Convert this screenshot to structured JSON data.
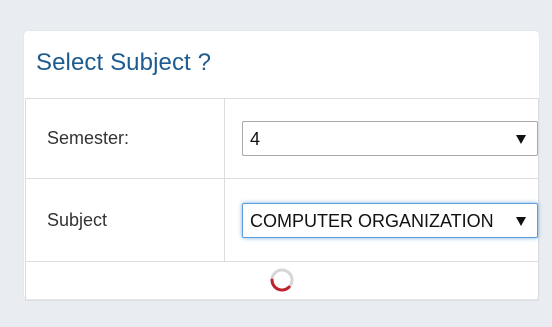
{
  "panel": {
    "title": "Select Subject ?"
  },
  "form": {
    "semester": {
      "label": "Semester:",
      "value": "4"
    },
    "subject": {
      "label": "Subject",
      "value": "COMPUTER ORGANIZATION"
    }
  },
  "colors": {
    "title": "#1d5b90",
    "spinner_accent": "#c0222a",
    "focus_border": "#5b9dd9"
  },
  "icons": {
    "dropdown": "chevron-down-icon",
    "loading": "loading-spinner-icon"
  }
}
